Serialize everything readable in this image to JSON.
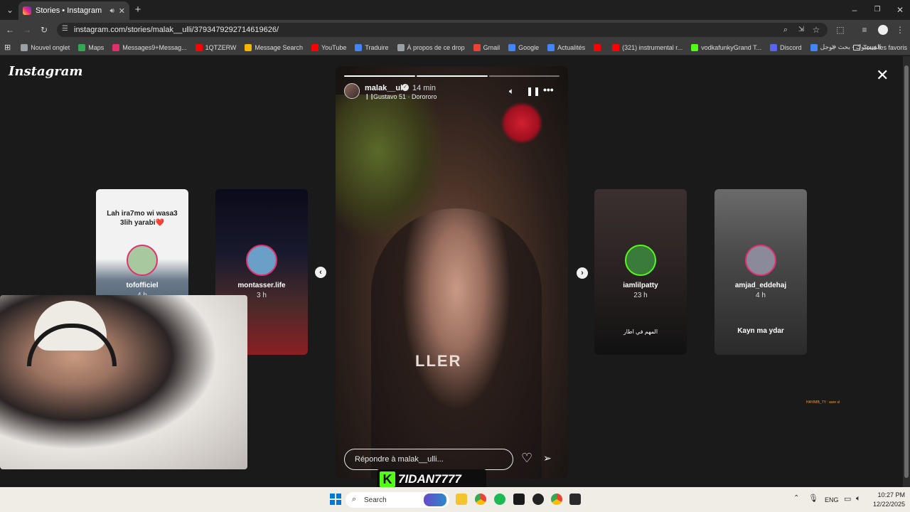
{
  "browser": {
    "tab_title": "Stories • Instagram",
    "url": "instagram.com/stories/malak__ulli/3793479292714619626/",
    "bookmarks": [
      {
        "label": "Nouvel onglet",
        "color": "#9aa0a6"
      },
      {
        "label": "Maps",
        "color": "#34a853"
      },
      {
        "label": "Messages9+Messag...",
        "color": "#e1306c"
      },
      {
        "label": "1QTZERW",
        "color": "#ff0000"
      },
      {
        "label": "Message Search",
        "color": "#f4b400"
      },
      {
        "label": "YouTube",
        "color": "#ff0000"
      },
      {
        "label": "Traduire",
        "color": "#4285f4"
      },
      {
        "label": "À propos de ce drop",
        "color": "#9aa0a6"
      },
      {
        "label": "Gmail",
        "color": "#ea4335"
      },
      {
        "label": "Google",
        "color": "#4285f4"
      },
      {
        "label": "Actualités",
        "color": "#4285f4"
      },
      {
        "label": "",
        "color": "#ff0000"
      },
      {
        "label": "(321) instrumental r...",
        "color": "#ff0000"
      },
      {
        "label": "vodkafunkyGrand T...",
        "color": "#53fc18"
      },
      {
        "label": "Discord",
        "color": "#5865f2"
      },
      {
        "label": "الفيسبوك - بحث جوجل",
        "color": "#4285f4"
      }
    ],
    "all_favorites": "Tous les favoris"
  },
  "instagram": {
    "logo": "Instagram",
    "story": {
      "username": "malak__ulli",
      "time": "14 min",
      "music": "Gustavo 51 · Dorororo",
      "reply_placeholder": "Répondre à malak__ulli...",
      "overlay_text": "LLER"
    },
    "side_stories_left": [
      {
        "name": "tofofficiel",
        "time": "4 h",
        "text": "Lah ira7mo wi wasa3 3lih yarabi❤️",
        "ring": "#e1306c"
      },
      {
        "name": "montasser.life",
        "time": "3 h",
        "text": "",
        "ring": "#e1306c"
      }
    ],
    "side_stories_right": [
      {
        "name": "iamlilpatty",
        "time": "23 h",
        "text": "المهم في اطار",
        "ring": "#53fc18"
      },
      {
        "name": "amjad_eddehaj",
        "time": "4 h",
        "text": "Kayn ma ydar",
        "ring": "#e1306c"
      }
    ],
    "corner_note": "HAYIMB_TY : ааrе sl"
  },
  "overlay": {
    "streamer_tag": "7IDAN7777",
    "brand_letter": "K",
    "brand_color": "#53fc18"
  },
  "taskbar": {
    "search_placeholder": "Search",
    "language": "ENG",
    "time": "10:27 PM",
    "date": "12/22/2025"
  }
}
